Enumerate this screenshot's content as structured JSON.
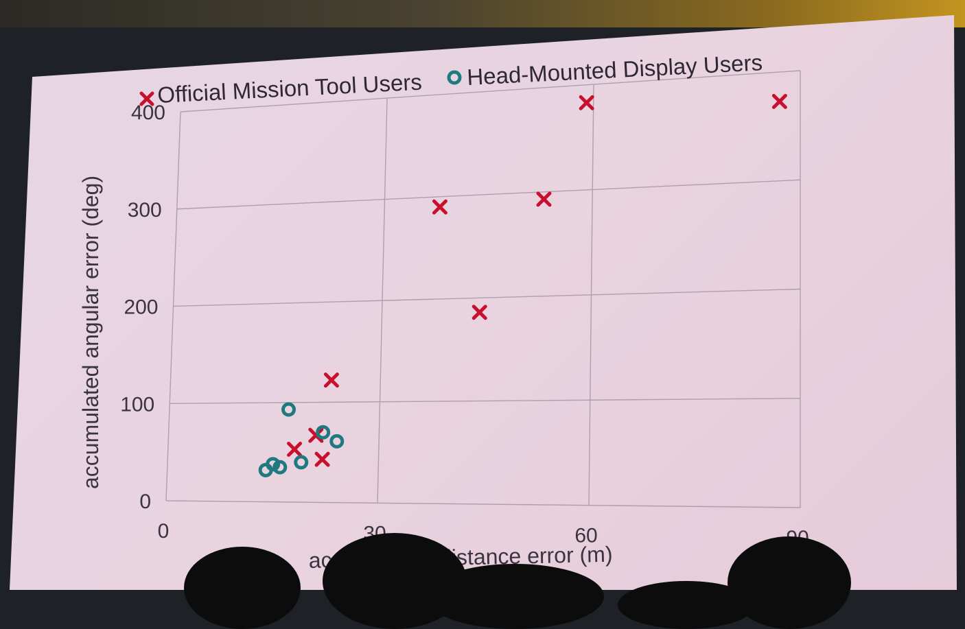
{
  "chart_data": {
    "type": "scatter",
    "xlabel": "accumulated distance error (m)",
    "ylabel": "accumulated angular error (deg)",
    "xlim": [
      0,
      90
    ],
    "ylim": [
      0,
      400
    ],
    "x_ticks": [
      "0",
      "30",
      "60",
      "90"
    ],
    "y_ticks": [
      "0",
      "100",
      "200",
      "300",
      "400"
    ],
    "grid": true,
    "legend_position": "top",
    "series": [
      {
        "name": "Official Mission Tool Users",
        "marker": "x",
        "color": "#c8102e",
        "points": [
          [
            59,
            383
          ],
          [
            87,
            373
          ],
          [
            38,
            290
          ],
          [
            53,
            293
          ],
          [
            44,
            186
          ],
          [
            23,
            122
          ],
          [
            21,
            67
          ],
          [
            18,
            53
          ],
          [
            22,
            43
          ]
        ]
      },
      {
        "name": "Head-Mounted Display Users",
        "marker": "o",
        "color": "#1f7a80",
        "points": [
          [
            17,
            93
          ],
          [
            22,
            70
          ],
          [
            24,
            61
          ],
          [
            19,
            40
          ],
          [
            15,
            38
          ],
          [
            16,
            35
          ],
          [
            14,
            32
          ]
        ]
      }
    ]
  }
}
